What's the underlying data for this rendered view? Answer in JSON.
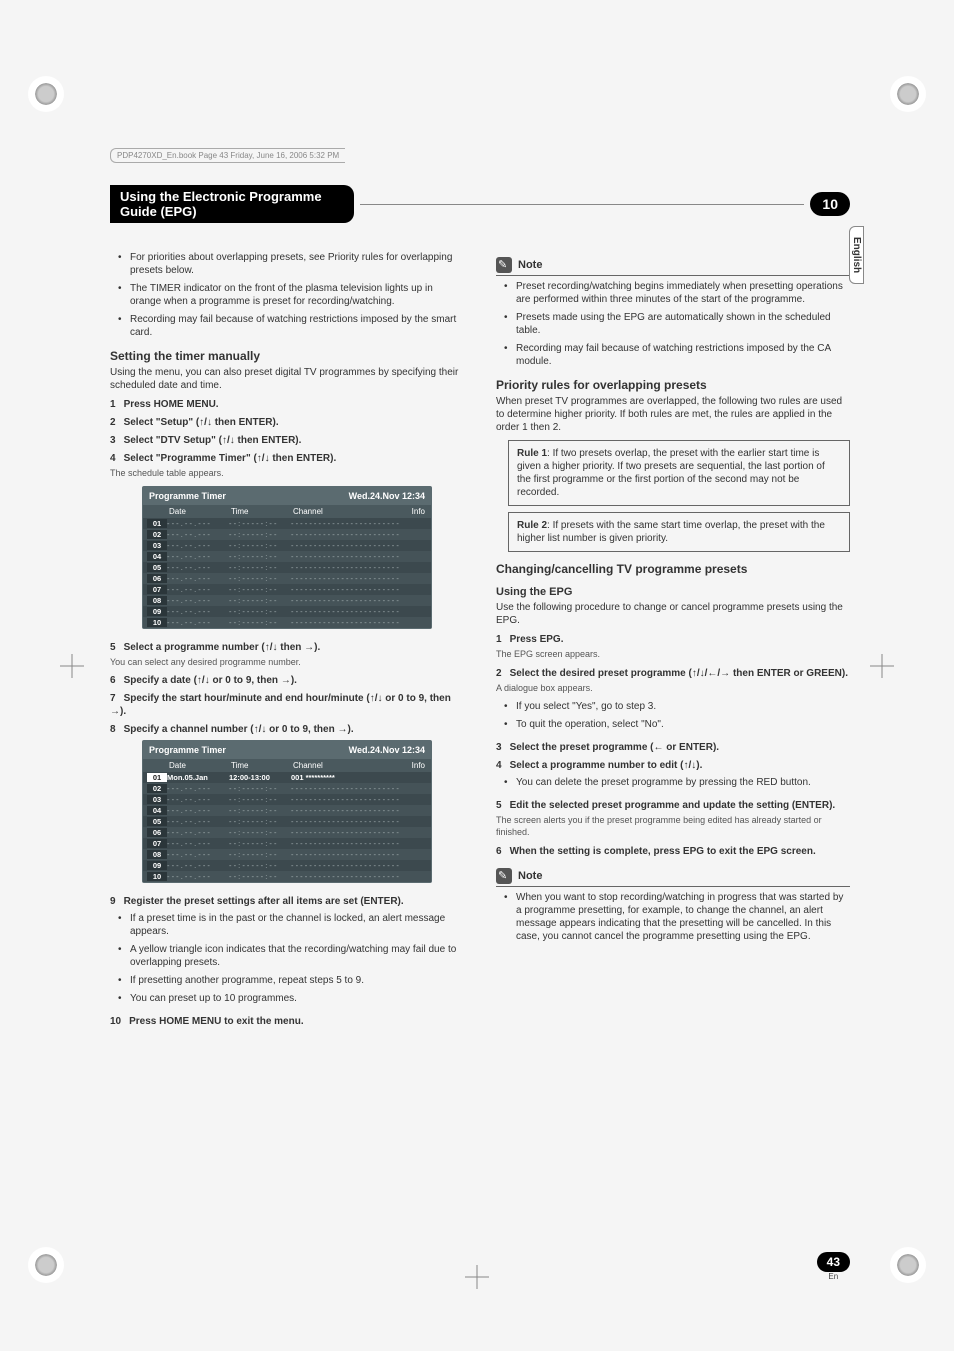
{
  "book_header": "PDP4270XD_En.book  Page 43  Friday, June 16, 2006  5:32 PM",
  "chapter": {
    "title": "Using the Electronic Programme Guide (EPG)",
    "num": "10"
  },
  "lang_tab": "English",
  "left": {
    "bullets1": [
      "For priorities about overlapping presets, see Priority rules for overlapping presets below.",
      "The TIMER indicator on the front of the plasma television lights up in orange when a programme is preset for recording/watching.",
      "Recording may fail because of watching restrictions imposed by the smart card."
    ],
    "h_setting": "Setting the timer manually",
    "p_setting": "Using the menu, you can also preset digital TV programmes by specifying their scheduled date and time.",
    "step1": {
      "n": "1",
      "t": "Press HOME MENU."
    },
    "step2": {
      "n": "2",
      "t": "Select \"Setup\" (↑/↓ then ENTER)."
    },
    "step3": {
      "n": "3",
      "t": "Select \"DTV Setup\" (↑/↓ then ENTER)."
    },
    "step4": {
      "n": "4",
      "t": "Select \"Programme Timer\" (↑/↓ then ENTER)."
    },
    "step4_sub": "The schedule table appears.",
    "table": {
      "title": "Programme Timer",
      "clock": "Wed.24.Nov 12:34",
      "cols": {
        "date": "Date",
        "time": "Time",
        "channel": "Channel",
        "info": "Info"
      },
      "rows": [
        "01",
        "02",
        "03",
        "04",
        "05",
        "06",
        "07",
        "08",
        "09",
        "10"
      ],
      "placeholder_date": "- - - . - - . - - -",
      "placeholder_time": "- - : - - - - - : - -",
      "placeholder_ch": "- - -  - - - - - - - - - - - - - - - - - - - - -"
    },
    "step5": {
      "n": "5",
      "t": "Select a programme number (↑/↓ then →)."
    },
    "step5_sub": "You can select any desired programme number.",
    "step6": {
      "n": "6",
      "t": "Specify a date (↑/↓ or 0 to 9, then →)."
    },
    "step7": {
      "n": "7",
      "t": "Specify the start hour/minute and end hour/minute (↑/↓ or 0 to 9, then →)."
    },
    "step8": {
      "n": "8",
      "t": "Specify a channel number (↑/↓ or 0 to 9, then →)."
    },
    "table2_row": {
      "date": "Mon.05.Jan",
      "time": "12:00-13:00",
      "ch": "001 **********"
    },
    "step9": {
      "n": "9",
      "t": "Register the preset settings after all items are set (ENTER)."
    },
    "bullets9": [
      "If a preset time is in the past or the channel is locked, an alert message appears.",
      "A yellow triangle icon indicates that the recording/watching may fail due to overlapping presets.",
      "If presetting another programme, repeat steps 5 to 9.",
      "You can preset up to 10 programmes."
    ],
    "step10": {
      "n": "10",
      "t": "Press HOME MENU to exit the menu."
    }
  },
  "right": {
    "note_label": "Note",
    "note1": [
      "Preset recording/watching begins immediately when presetting operations are performed within three minutes of the start of the programme.",
      "Presets made using the EPG are automatically shown in the scheduled table.",
      "Recording may fail because of watching restrictions imposed by the CA module."
    ],
    "h_priority": "Priority rules for overlapping presets",
    "p_priority": "When preset TV programmes are overlapped, the following two rules are used to determine higher priority. If both rules are met, the rules are applied in the order 1 then 2.",
    "rule1_label": "Rule 1",
    "rule1": ": If two presets overlap, the preset with the earlier start time is given a higher priority. If two presets are sequential, the last portion of the first programme or the first portion of the second may not be recorded.",
    "rule2_label": "Rule 2",
    "rule2": ": If presets with the same start time overlap, the preset with the higher list number is given priority.",
    "h_change": "Changing/cancelling TV programme presets",
    "h_epg": "Using the EPG",
    "p_epg": "Use the following procedure to change or cancel programme presets using the EPG.",
    "r_step1": {
      "n": "1",
      "t": "Press EPG."
    },
    "r_step1_sub": "The EPG screen appears.",
    "r_step2": {
      "n": "2",
      "t": "Select the desired preset programme (↑/↓/←/→ then ENTER or GREEN)."
    },
    "r_step2_sub": "A dialogue box appears.",
    "r_bullets2": [
      "If you select \"Yes\", go to step 3.",
      "To quit the operation, select \"No\"."
    ],
    "r_step3": {
      "n": "3",
      "t": "Select the preset programme (← or ENTER)."
    },
    "r_step4": {
      "n": "4",
      "t": "Select a programme number to edit (↑/↓)."
    },
    "r_step4_b": "You can delete the preset programme by pressing the RED button.",
    "r_step5": {
      "n": "5",
      "t": "Edit the selected preset programme and update the setting (ENTER)."
    },
    "r_step5_sub": "The screen alerts you if the preset programme being edited has already started or finished.",
    "r_step6": {
      "n": "6",
      "t": "When the setting is complete, press EPG to exit the EPG screen."
    },
    "note2": [
      "When you want to stop recording/watching in progress that was started by a programme presetting, for example, to change the channel, an alert message appears indicating that the presetting will be cancelled. In this case, you cannot cancel the programme presetting using the EPG."
    ]
  },
  "page_num": {
    "num": "43",
    "en": "En"
  }
}
